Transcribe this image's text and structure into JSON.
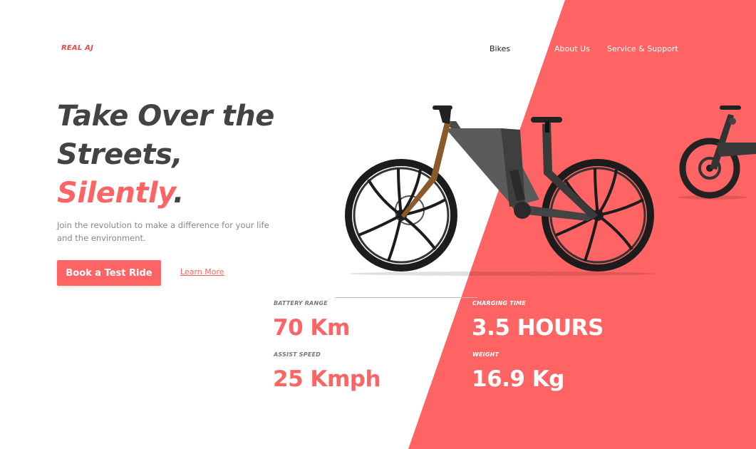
{
  "brand": {
    "name": "REAL AJ"
  },
  "nav": {
    "bikes": "Bikes",
    "about": "About Us",
    "service": "Service & Support"
  },
  "hero": {
    "line1": "Take Over the",
    "line2": "Streets,",
    "accent": "Silently",
    "period": ".",
    "subtitle": "Join the revolution to make a difference for your life and the environment."
  },
  "actions": {
    "test_ride": "Book a Test Ride",
    "learn_more": "Learn More"
  },
  "stats": {
    "battery_range": {
      "label": "BATTERY RANGE",
      "value": "70 Km"
    },
    "assist_speed": {
      "label": "ASSIST SPEED",
      "value": "25 Kmph"
    },
    "charging_time": {
      "label": "CHARGING TIME",
      "value": "3.5 HOURS"
    },
    "weight": {
      "label": "WEIGHT",
      "value": "16.9 Kg"
    }
  },
  "colors": {
    "accent": "#ff6464",
    "heading": "#434343",
    "background": "#ffffff"
  },
  "images": {
    "main_bike": "electric-mountain-bike-image",
    "side_bike": "electric-city-bike-image"
  }
}
